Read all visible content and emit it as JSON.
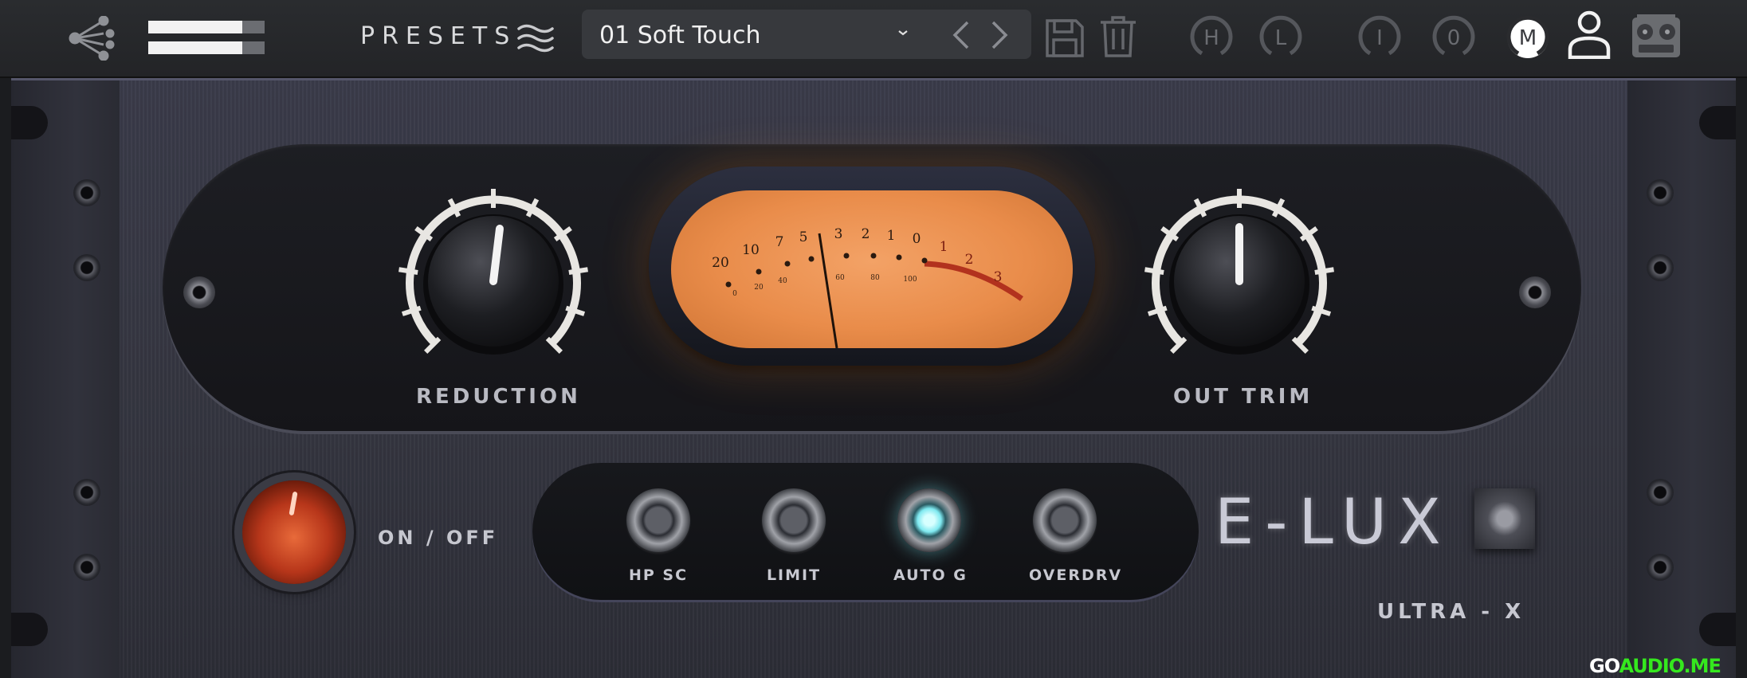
{
  "toolbar": {
    "presets_label": "PRESETS",
    "preset_name": "01 Soft Touch",
    "buttons": [
      {
        "letter": "H"
      },
      {
        "letter": "L"
      },
      {
        "letter": "I"
      },
      {
        "letter": "0"
      },
      {
        "letter": "M"
      }
    ]
  },
  "controls": {
    "reduction_label": "REDUCTION",
    "out_trim_label": "OUT TRIM",
    "onoff_label": "ON / OFF",
    "power_on": true
  },
  "vu_meter": {
    "upper_scale": [
      "20",
      "10",
      "7",
      "5",
      "3",
      "2",
      "1",
      "0",
      "1",
      "2",
      "3"
    ],
    "lower_scale": [
      "0",
      "20",
      "40",
      "60",
      "80",
      "100"
    ]
  },
  "switches": [
    {
      "label": "HP SC",
      "on": false
    },
    {
      "label": "LIMIT",
      "on": false
    },
    {
      "label": "AUTO G",
      "on": true
    },
    {
      "label": "OVERDRV",
      "on": false
    }
  ],
  "branding": {
    "name": "E-LUX",
    "model": "ULTRA - X",
    "watermark_a": "GO",
    "watermark_b": "AUDIO.ME"
  },
  "colors": {
    "toolbar_bg": "#26282b",
    "rack_bg": "#363744",
    "vu_face": "#e98c4a",
    "switch_active": "#7fe9f0",
    "power_led": "#c23c1d",
    "watermark_green": "#35e81e"
  }
}
